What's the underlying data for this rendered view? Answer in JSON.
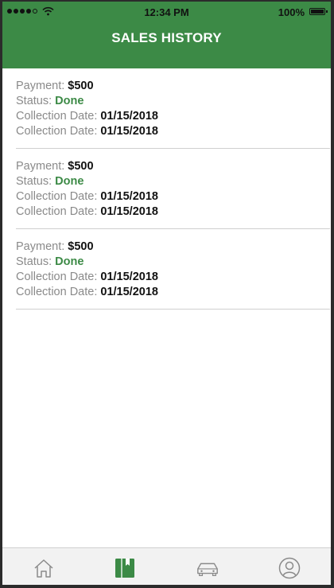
{
  "status_bar": {
    "time": "12:34 PM",
    "battery": "100%"
  },
  "header": {
    "title": "SALES HISTORY"
  },
  "sales": [
    {
      "payment_label": "Payment:",
      "payment": "$500",
      "status_label": "Status:",
      "status": "Done",
      "collection_label_1": "Collection Date:",
      "collection_date_1": "01/15/2018",
      "collection_label_2": "Collection Date:",
      "collection_date_2": "01/15/2018"
    },
    {
      "payment_label": "Payment:",
      "payment": "$500",
      "status_label": "Status:",
      "status": "Done",
      "collection_label_1": "Collection Date:",
      "collection_date_1": "01/15/2018",
      "collection_label_2": "Collection Date:",
      "collection_date_2": "01/15/2018"
    },
    {
      "payment_label": "Payment:",
      "payment": "$500",
      "status_label": "Status:",
      "status": "Done",
      "collection_label_1": "Collection Date:",
      "collection_date_1": "01/15/2018",
      "collection_label_2": "Collection Date:",
      "collection_date_2": "01/15/2018"
    }
  ],
  "tabbar": {
    "items": [
      {
        "icon": "home-icon",
        "active": false
      },
      {
        "icon": "book-icon",
        "active": true
      },
      {
        "icon": "car-icon",
        "active": false
      },
      {
        "icon": "profile-icon",
        "active": false
      }
    ]
  },
  "colors": {
    "brand_green": "#3c8a46",
    "inactive_icon": "#8a8a8a"
  }
}
